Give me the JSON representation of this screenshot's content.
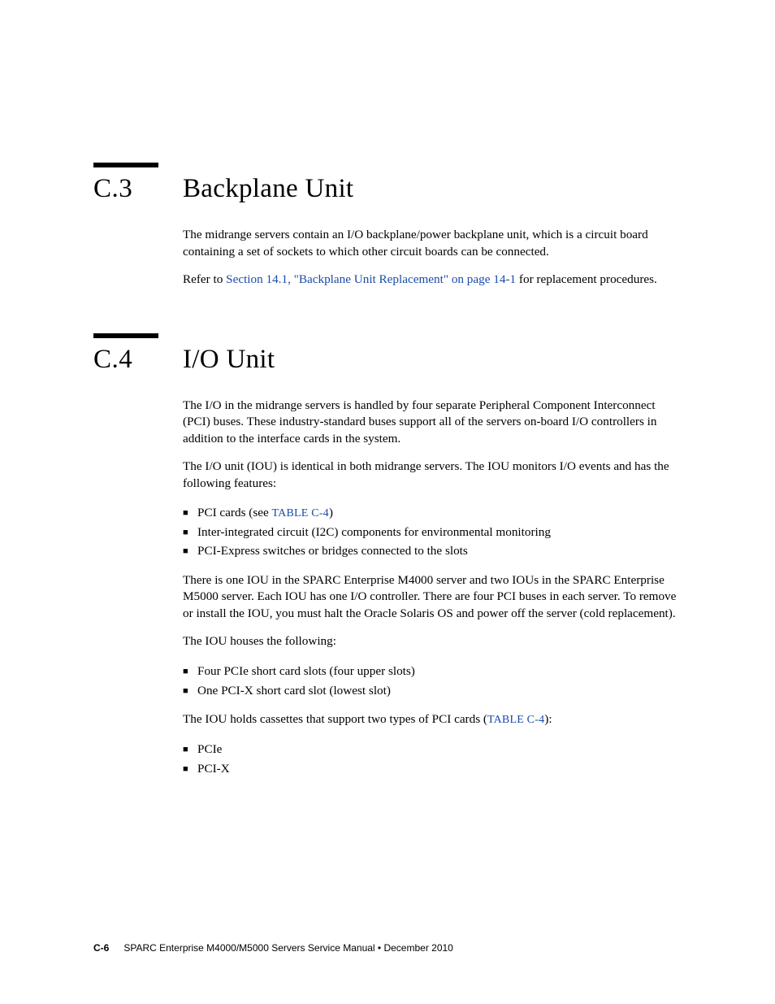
{
  "sections": {
    "c3": {
      "num": "C.3",
      "title": "Backplane Unit",
      "p1": "The midrange servers contain an I/O backplane/power backplane unit, which is a circuit board containing a set of sockets to which other circuit boards can be connected.",
      "p2_lead": "Refer to ",
      "p2_link": "Section 14.1, \"Backplane Unit Replacement\" on page 14-1",
      "p2_tail": " for replacement procedures."
    },
    "c4": {
      "num": "C.4",
      "title": "I/O Unit",
      "p1": "The I/O in the midrange servers is handled by four separate Peripheral Component Interconnect (PCI) buses. These industry-standard buses support all of the servers on-board I/O controllers in addition to the interface cards in the system.",
      "p2": "The I/O unit (IOU) is identical in both midrange servers. The IOU monitors I/O events and has the following features:",
      "list1": {
        "i1_lead": "PCI cards (see ",
        "i1_link": "TABLE C-4",
        "i1_tail": ")",
        "i2": "Inter-integrated circuit (I2C) components for environmental monitoring",
        "i3": "PCI-Express switches or bridges connected to the slots"
      },
      "p3": "There is one IOU in the SPARC Enterprise M4000 server and two IOUs in the SPARC Enterprise M5000 server. Each IOU has one I/O controller. There are four PCI buses in each server. To remove or install the IOU, you must halt the Oracle Solaris OS and power off the server (cold replacement).",
      "p4": "The IOU houses the following:",
      "list2": {
        "i1": "Four PCIe short card slots (four upper slots)",
        "i2": "One PCI-X short card slot (lowest slot)"
      },
      "p5_lead": "The IOU holds cassettes that support two types of PCI cards (",
      "p5_link": "TABLE C-4",
      "p5_tail": "):",
      "list3": {
        "i1": "PCIe",
        "i2": "PCI-X"
      }
    }
  },
  "footer": {
    "pagenum": "C-6",
    "text": "SPARC Enterprise M4000/M5000 Servers Service Manual  •  December 2010"
  }
}
